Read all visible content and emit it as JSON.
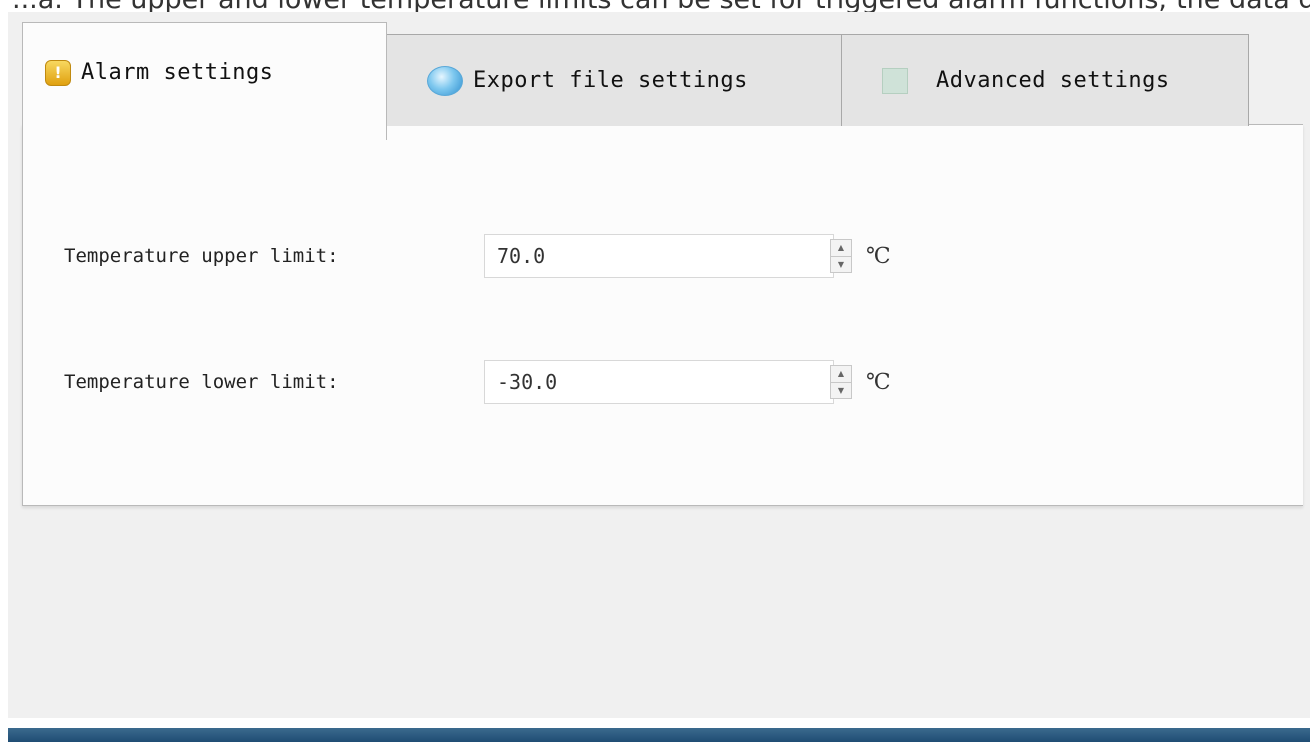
{
  "header_partial_text": "...a. The upper and lower temperature limits can be set for triggered alarm functions; the data displayed in...",
  "tabs": [
    {
      "label": "Alarm settings",
      "icon": "alarm-icon",
      "active": true
    },
    {
      "label": "Export file settings",
      "icon": "export-icon",
      "active": false
    },
    {
      "label": "Advanced settings",
      "icon": "advanced-icon",
      "active": false
    }
  ],
  "fields": {
    "upper": {
      "label": "Temperature upper limit:",
      "value": "70.0",
      "unit": "℃"
    },
    "lower": {
      "label": "Temperature lower limit:",
      "value": "-30.0",
      "unit": "℃"
    }
  },
  "colors": {
    "alarm_icon": "#e8b020",
    "export_icon": "#4aa6dd",
    "taskbar": "#2b5a80"
  }
}
